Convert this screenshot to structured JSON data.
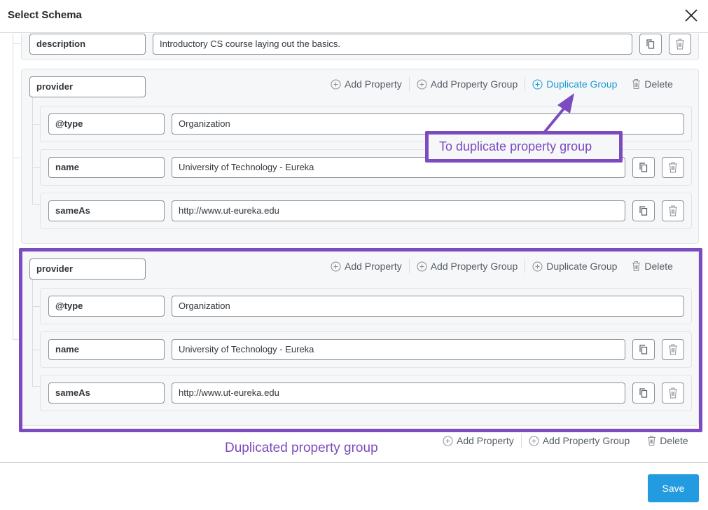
{
  "header": {
    "title": "Select Schema",
    "close_icon": "close-icon"
  },
  "top_row": {
    "key": "description",
    "value": "Introductory CS course laying out the basics."
  },
  "actions": {
    "add_property": "Add Property",
    "add_property_group": "Add Property Group",
    "duplicate_group": "Duplicate Group",
    "delete": "Delete"
  },
  "groups": [
    {
      "key": "provider",
      "highlighted_action": "duplicate_group",
      "rows": [
        {
          "key": "@type",
          "value": "Organization"
        },
        {
          "key": "name",
          "value": "University of Technology - Eureka"
        },
        {
          "key": "sameAs",
          "value": "http://www.ut-eureka.edu"
        }
      ]
    },
    {
      "key": "provider",
      "rows": [
        {
          "key": "@type",
          "value": "Organization"
        },
        {
          "key": "name",
          "value": "University of Technology - Eureka"
        },
        {
          "key": "sameAs",
          "value": "http://www.ut-eureka.edu"
        }
      ]
    }
  ],
  "bottom_actions": {
    "add_property": "Add Property",
    "add_property_group": "Add Property Group",
    "delete": "Delete"
  },
  "annotations": {
    "duplicate_callout": "To duplicate property group",
    "duplicated_label": "Duplicated property group",
    "color": "#7b4bbf"
  },
  "footer": {
    "save_label": "Save"
  },
  "colors": {
    "accent": "#239be0",
    "link_active": "#1e9ad6"
  }
}
